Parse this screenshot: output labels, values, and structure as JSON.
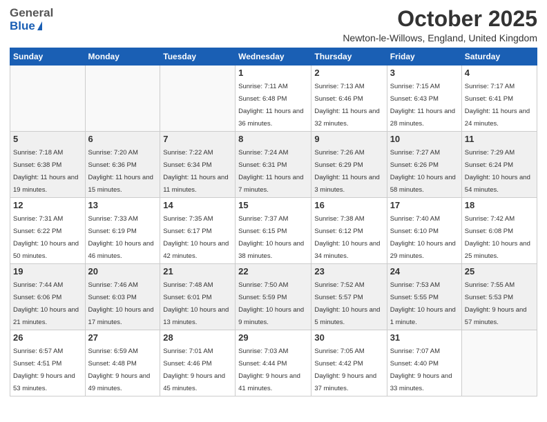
{
  "logo": {
    "general": "General",
    "blue": "Blue"
  },
  "title": "October 2025",
  "location": "Newton-le-Willows, England, United Kingdom",
  "weekdays": [
    "Sunday",
    "Monday",
    "Tuesday",
    "Wednesday",
    "Thursday",
    "Friday",
    "Saturday"
  ],
  "weeks": [
    [
      {
        "day": "",
        "sunrise": "",
        "sunset": "",
        "daylight": ""
      },
      {
        "day": "",
        "sunrise": "",
        "sunset": "",
        "daylight": ""
      },
      {
        "day": "",
        "sunrise": "",
        "sunset": "",
        "daylight": ""
      },
      {
        "day": "1",
        "sunrise": "Sunrise: 7:11 AM",
        "sunset": "Sunset: 6:48 PM",
        "daylight": "Daylight: 11 hours and 36 minutes."
      },
      {
        "day": "2",
        "sunrise": "Sunrise: 7:13 AM",
        "sunset": "Sunset: 6:46 PM",
        "daylight": "Daylight: 11 hours and 32 minutes."
      },
      {
        "day": "3",
        "sunrise": "Sunrise: 7:15 AM",
        "sunset": "Sunset: 6:43 PM",
        "daylight": "Daylight: 11 hours and 28 minutes."
      },
      {
        "day": "4",
        "sunrise": "Sunrise: 7:17 AM",
        "sunset": "Sunset: 6:41 PM",
        "daylight": "Daylight: 11 hours and 24 minutes."
      }
    ],
    [
      {
        "day": "5",
        "sunrise": "Sunrise: 7:18 AM",
        "sunset": "Sunset: 6:38 PM",
        "daylight": "Daylight: 11 hours and 19 minutes."
      },
      {
        "day": "6",
        "sunrise": "Sunrise: 7:20 AM",
        "sunset": "Sunset: 6:36 PM",
        "daylight": "Daylight: 11 hours and 15 minutes."
      },
      {
        "day": "7",
        "sunrise": "Sunrise: 7:22 AM",
        "sunset": "Sunset: 6:34 PM",
        "daylight": "Daylight: 11 hours and 11 minutes."
      },
      {
        "day": "8",
        "sunrise": "Sunrise: 7:24 AM",
        "sunset": "Sunset: 6:31 PM",
        "daylight": "Daylight: 11 hours and 7 minutes."
      },
      {
        "day": "9",
        "sunrise": "Sunrise: 7:26 AM",
        "sunset": "Sunset: 6:29 PM",
        "daylight": "Daylight: 11 hours and 3 minutes."
      },
      {
        "day": "10",
        "sunrise": "Sunrise: 7:27 AM",
        "sunset": "Sunset: 6:26 PM",
        "daylight": "Daylight: 10 hours and 58 minutes."
      },
      {
        "day": "11",
        "sunrise": "Sunrise: 7:29 AM",
        "sunset": "Sunset: 6:24 PM",
        "daylight": "Daylight: 10 hours and 54 minutes."
      }
    ],
    [
      {
        "day": "12",
        "sunrise": "Sunrise: 7:31 AM",
        "sunset": "Sunset: 6:22 PM",
        "daylight": "Daylight: 10 hours and 50 minutes."
      },
      {
        "day": "13",
        "sunrise": "Sunrise: 7:33 AM",
        "sunset": "Sunset: 6:19 PM",
        "daylight": "Daylight: 10 hours and 46 minutes."
      },
      {
        "day": "14",
        "sunrise": "Sunrise: 7:35 AM",
        "sunset": "Sunset: 6:17 PM",
        "daylight": "Daylight: 10 hours and 42 minutes."
      },
      {
        "day": "15",
        "sunrise": "Sunrise: 7:37 AM",
        "sunset": "Sunset: 6:15 PM",
        "daylight": "Daylight: 10 hours and 38 minutes."
      },
      {
        "day": "16",
        "sunrise": "Sunrise: 7:38 AM",
        "sunset": "Sunset: 6:12 PM",
        "daylight": "Daylight: 10 hours and 34 minutes."
      },
      {
        "day": "17",
        "sunrise": "Sunrise: 7:40 AM",
        "sunset": "Sunset: 6:10 PM",
        "daylight": "Daylight: 10 hours and 29 minutes."
      },
      {
        "day": "18",
        "sunrise": "Sunrise: 7:42 AM",
        "sunset": "Sunset: 6:08 PM",
        "daylight": "Daylight: 10 hours and 25 minutes."
      }
    ],
    [
      {
        "day": "19",
        "sunrise": "Sunrise: 7:44 AM",
        "sunset": "Sunset: 6:06 PM",
        "daylight": "Daylight: 10 hours and 21 minutes."
      },
      {
        "day": "20",
        "sunrise": "Sunrise: 7:46 AM",
        "sunset": "Sunset: 6:03 PM",
        "daylight": "Daylight: 10 hours and 17 minutes."
      },
      {
        "day": "21",
        "sunrise": "Sunrise: 7:48 AM",
        "sunset": "Sunset: 6:01 PM",
        "daylight": "Daylight: 10 hours and 13 minutes."
      },
      {
        "day": "22",
        "sunrise": "Sunrise: 7:50 AM",
        "sunset": "Sunset: 5:59 PM",
        "daylight": "Daylight: 10 hours and 9 minutes."
      },
      {
        "day": "23",
        "sunrise": "Sunrise: 7:52 AM",
        "sunset": "Sunset: 5:57 PM",
        "daylight": "Daylight: 10 hours and 5 minutes."
      },
      {
        "day": "24",
        "sunrise": "Sunrise: 7:53 AM",
        "sunset": "Sunset: 5:55 PM",
        "daylight": "Daylight: 10 hours and 1 minute."
      },
      {
        "day": "25",
        "sunrise": "Sunrise: 7:55 AM",
        "sunset": "Sunset: 5:53 PM",
        "daylight": "Daylight: 9 hours and 57 minutes."
      }
    ],
    [
      {
        "day": "26",
        "sunrise": "Sunrise: 6:57 AM",
        "sunset": "Sunset: 4:51 PM",
        "daylight": "Daylight: 9 hours and 53 minutes."
      },
      {
        "day": "27",
        "sunrise": "Sunrise: 6:59 AM",
        "sunset": "Sunset: 4:48 PM",
        "daylight": "Daylight: 9 hours and 49 minutes."
      },
      {
        "day": "28",
        "sunrise": "Sunrise: 7:01 AM",
        "sunset": "Sunset: 4:46 PM",
        "daylight": "Daylight: 9 hours and 45 minutes."
      },
      {
        "day": "29",
        "sunrise": "Sunrise: 7:03 AM",
        "sunset": "Sunset: 4:44 PM",
        "daylight": "Daylight: 9 hours and 41 minutes."
      },
      {
        "day": "30",
        "sunrise": "Sunrise: 7:05 AM",
        "sunset": "Sunset: 4:42 PM",
        "daylight": "Daylight: 9 hours and 37 minutes."
      },
      {
        "day": "31",
        "sunrise": "Sunrise: 7:07 AM",
        "sunset": "Sunset: 4:40 PM",
        "daylight": "Daylight: 9 hours and 33 minutes."
      },
      {
        "day": "",
        "sunrise": "",
        "sunset": "",
        "daylight": ""
      }
    ]
  ]
}
